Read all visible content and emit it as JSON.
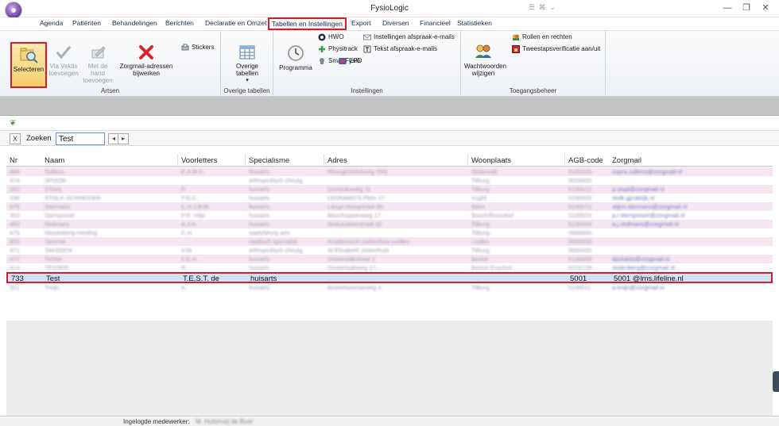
{
  "window": {
    "title": "FysioLogic",
    "title_mini": "☰ ⌘ ⌄",
    "minimize": "—",
    "restore": "❐",
    "close": "✕"
  },
  "menu": {
    "items": [
      "Agenda",
      "Patiënten",
      "Behandelingen",
      "Berichten",
      "Declaratie en Omzet",
      "Tabellen en Instellingen",
      "Export",
      "Diversen",
      "Financieel",
      "Statistieken"
    ],
    "active_index": 5
  },
  "ribbon": {
    "artsen": {
      "label": "Artsen",
      "selecteren": "Selecteren",
      "via_vektis": "Via Vektis toevoegen",
      "met_de_hand": "Met de hand toevoegen",
      "zorgmail": "Zorgmail-adressen bijwerken",
      "stickers": "Stickers"
    },
    "overige": {
      "label": "Overige tabellen",
      "button": "Overige tabellen"
    },
    "instellingen": {
      "label": "Instellingen",
      "programma": "Programma",
      "hwo": "HWO",
      "physitrack": "Physitrack",
      "smartfysio": "SmartFysio",
      "afspraak_emails": "Instellingen afspraak-e-mails",
      "tekst_afspraak": "Tekst afspraak-e-mails",
      "epd": "EPD"
    },
    "toegang": {
      "label": "Toegangsbeheer",
      "wachtwoorden": "Wachtwoorden wijzigen",
      "rollen": "Rollen en rechten",
      "tweestaps": "Tweestapsverificatie aan/uit"
    }
  },
  "search": {
    "label": "Zoeken",
    "value": "Test",
    "clear": "X",
    "prev": "◂",
    "next": "▸"
  },
  "table": {
    "headers": [
      "Nr",
      "Naam",
      "Voorletters",
      "Specialisme",
      "Adres",
      "Woonplaats",
      "AGB-code",
      "Zorgmail"
    ],
    "rows": [
      [
        "486",
        "Sullens",
        "E.A.M.C.",
        "huisarts",
        "Moergestelseweg 2(H)",
        "Oisterwijk",
        "0100005",
        "sopra.sullens@zorgmail.nl"
      ],
      [
        "374",
        "SPOOR",
        "",
        "orthopedisch chirurg",
        "",
        "Tilburg",
        "0005000",
        ""
      ],
      [
        "242",
        "STAAL",
        "P.",
        "huisarts",
        "Dominiksweg 11",
        "Tilburg",
        "0100012",
        "p.staal@zorgmail.nl"
      ],
      [
        "338",
        "STOLK-SCHNEIDER",
        "P.G.C.",
        "huisarts",
        "LEONARD'S Plein 17",
        "Vught",
        "0100025",
        "stolk.gpraktijk.nl"
      ],
      [
        "575",
        "Stermans",
        "C.H.J.B.M.",
        "huisarts",
        "Lange Hoogstraat 65",
        "Gilze",
        "0100071",
        "stijnn.stermans@zorgmail.nl"
      ],
      [
        "303",
        "Stempvoort",
        "P.R. Hilje",
        "huisarts",
        "Bisschoppenweg 17",
        "Bosch/Roosdorf",
        "0100024",
        "p.r.stempvoort@zorgmail.nl"
      ],
      [
        "483",
        "Stolmans",
        "A.J.H.",
        "huisarts",
        "Stokstukkerstraat 32",
        "Tilburg",
        "0100009",
        "a.j.stolmans@zorgmail.nl"
      ],
      [
        "479",
        "Stuvenberg-Heeling",
        "C.H.",
        "vaatchirurg arts",
        "",
        "Tilburg",
        "0000000",
        ""
      ],
      [
        "502",
        "Tammie",
        "",
        "medisch specialist",
        "Academisch ziekenhuis Leiden",
        "Leiden",
        "0000000",
        ""
      ],
      [
        "371",
        "TAKEDEN",
        "V.M.",
        "orthopedisch chirurg",
        "St Elisabeth ziekenhuis",
        "Tilburg",
        "0000000",
        ""
      ],
      [
        "477",
        "Tichter",
        "F.G.H.",
        "huisarts",
        "Oosterwijkstraat 2",
        "Borkel",
        "0100009",
        "tijsvlakte@zorgmail.nl"
      ],
      [
        "414",
        "TESSER",
        "R.",
        "huisarts",
        "Oosterlaakweg 17",
        "Berkel-Enschot",
        "0102129",
        "stolenberg@zorgmail.nl"
      ],
      [
        "733",
        "Test",
        "T.E.S.T. de",
        "huisarts",
        "",
        "",
        "5001",
        "5001        @lms.lifeline.nl"
      ],
      [
        "321",
        "Tmijn",
        "A.",
        "huisarts",
        "Broekhovenseweg 4",
        "Tilburg",
        "0100011",
        "a.tmijn@zorgmail.nl"
      ]
    ],
    "selected_index": 12
  },
  "status": {
    "label": "Ingelogde medewerker:",
    "value": "M. Hufsmoij de Boer"
  },
  "colors": {
    "accent_red": "#d21d2a",
    "row_pink": "#f6e6f2",
    "row_selected": "#cfe1f5",
    "menu_text": "#1e2a55"
  }
}
